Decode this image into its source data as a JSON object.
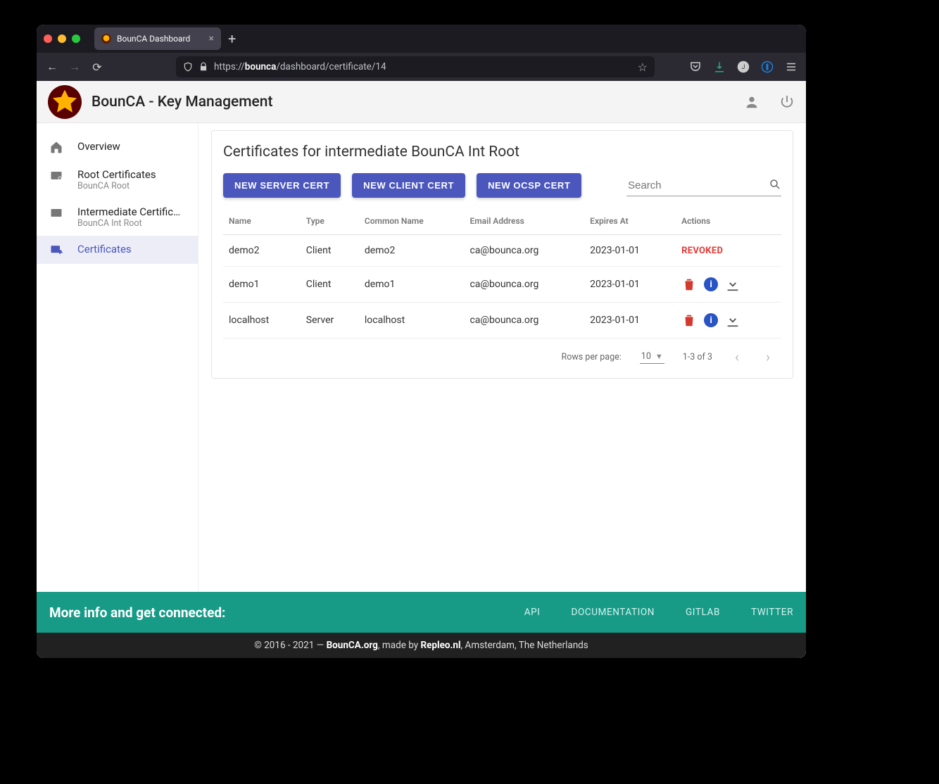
{
  "browser": {
    "tab_title": "BounCA Dashboard",
    "url_prefix": "https://",
    "url_host": "bounca",
    "url_path": "/dashboard/certificate/14"
  },
  "header": {
    "app_title": "BounCA - Key Management"
  },
  "sidebar": {
    "items": [
      {
        "label": "Overview",
        "sub": ""
      },
      {
        "label": "Root Certificates",
        "sub": "BounCA Root"
      },
      {
        "label": "Intermediate Certifica…",
        "sub": "BounCA Int Root"
      },
      {
        "label": "Certificates",
        "sub": ""
      }
    ]
  },
  "card": {
    "title": "Certificates for intermediate BounCA Int Root",
    "buttons": {
      "server": "NEW SERVER CERT",
      "client": "NEW CLIENT CERT",
      "ocsp": "NEW OCSP CERT"
    },
    "search_placeholder": "Search",
    "columns": [
      "Name",
      "Type",
      "Common Name",
      "Email Address",
      "Expires At",
      "Actions"
    ],
    "rows": [
      {
        "name": "demo2",
        "type": "Client",
        "cn": "demo2",
        "email": "ca@bounca.org",
        "expires": "2023-01-01",
        "revoked": true
      },
      {
        "name": "demo1",
        "type": "Client",
        "cn": "demo1",
        "email": "ca@bounca.org",
        "expires": "2023-01-01",
        "revoked": false
      },
      {
        "name": "localhost",
        "type": "Server",
        "cn": "localhost",
        "email": "ca@bounca.org",
        "expires": "2023-01-01",
        "revoked": false
      }
    ],
    "revoked_label": "REVOKED",
    "pager": {
      "rows_per_page_label": "Rows per page:",
      "rows_per_page_value": "10",
      "range": "1-3 of 3"
    }
  },
  "footer": {
    "headline": "More info and get connected:",
    "links": [
      "API",
      "DOCUMENTATION",
      "GITLAB",
      "TWITTER"
    ],
    "copyright_pre": "© 2016 - 2021 — ",
    "org": "BounCA.org",
    "made_by_pre": ", made by ",
    "made_by": "Repleo.nl",
    "made_by_post": ", Amsterdam, The Netherlands"
  }
}
